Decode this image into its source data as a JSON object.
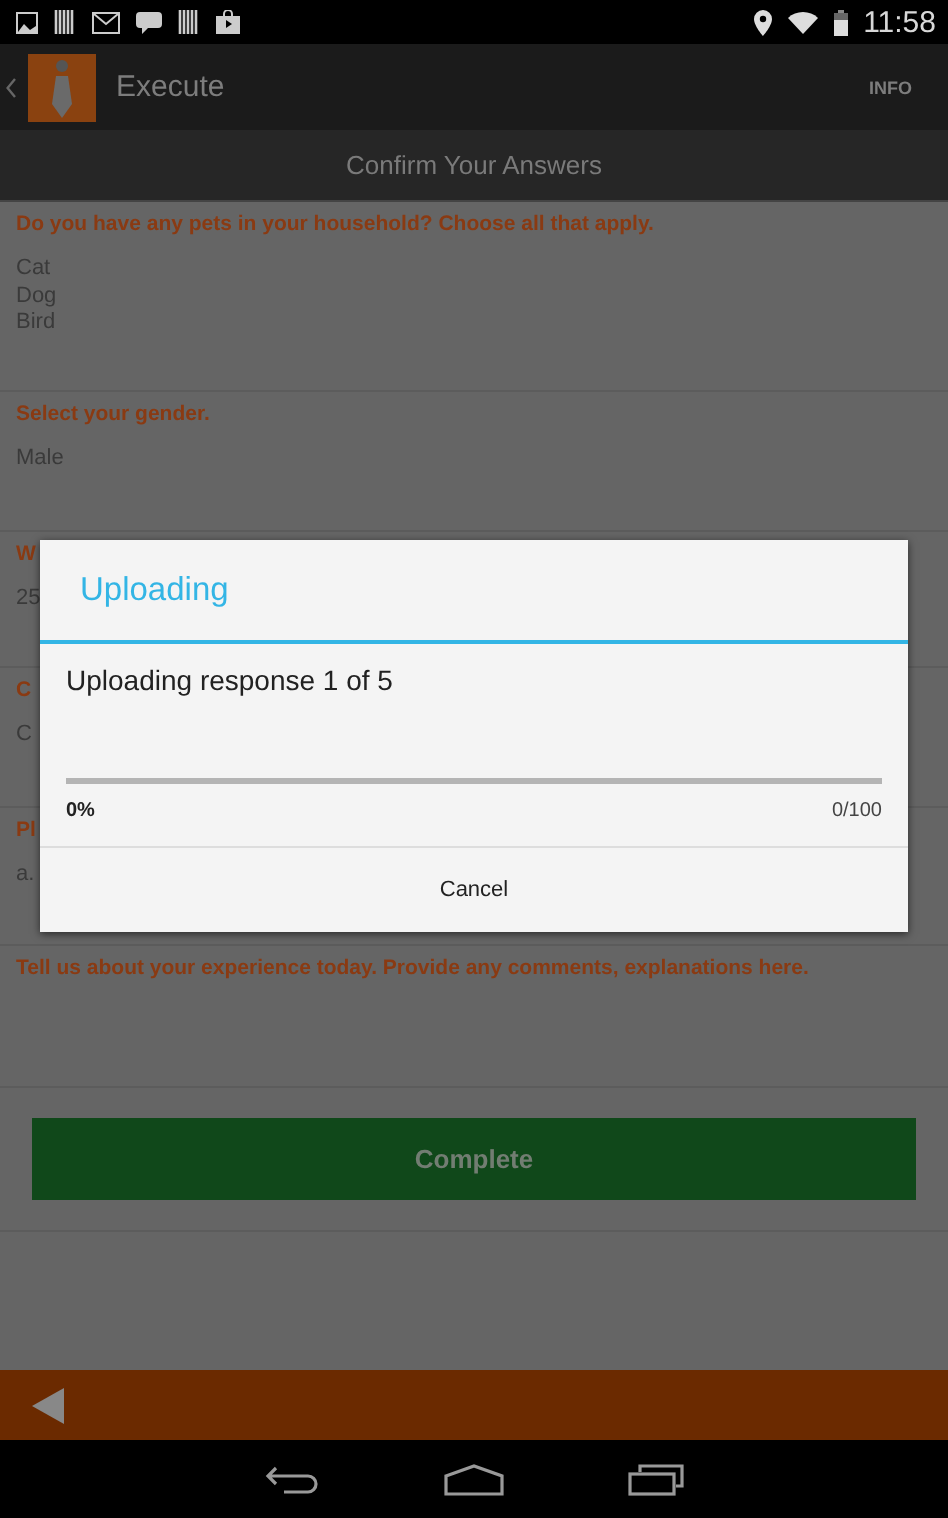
{
  "status_bar": {
    "time": "11:58"
  },
  "action_bar": {
    "title": "Execute",
    "action": "INFO"
  },
  "subtitle": "Confirm Your Answers",
  "questions": [
    {
      "question": "Do you have any pets in your household? Choose all that apply.",
      "answers": [
        "Cat",
        "Dog",
        "Bird"
      ]
    },
    {
      "question": "Select your gender.",
      "answers": [
        "Male"
      ]
    },
    {
      "question": "W",
      "answers": [
        "25"
      ]
    },
    {
      "question": "C",
      "answers": [
        "C"
      ]
    },
    {
      "question": "Pl",
      "answers": [
        "a."
      ]
    },
    {
      "question": "Tell us about your experience today. Provide any comments, explanations here."
    }
  ],
  "complete_button": "Complete",
  "dialog": {
    "title": "Uploading",
    "message": "Uploading response 1 of 5",
    "progress": {
      "level": 0,
      "percent": "0%",
      "count": "0/100"
    },
    "button": "Cancel"
  }
}
